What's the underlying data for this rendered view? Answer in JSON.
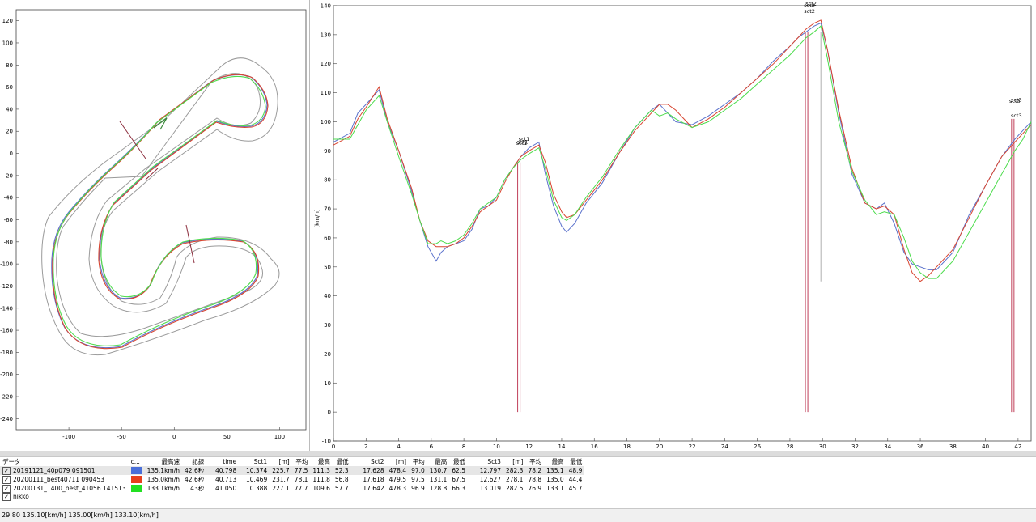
{
  "map": {
    "y_ticks": [
      "120",
      "100",
      "80",
      "60",
      "40",
      "20",
      "0",
      "-20",
      "-40",
      "-60",
      "-80",
      "-100",
      "-120",
      "-140",
      "-160",
      "-180",
      "-200",
      "-220",
      "-240"
    ],
    "x_ticks": [
      "-100",
      "-50",
      "0",
      "50",
      "100"
    ]
  },
  "speed_chart": {
    "ylabel": "[km/h]",
    "y_ticks": [
      "140",
      "130",
      "120",
      "110",
      "100",
      "90",
      "80",
      "70",
      "60",
      "50",
      "40",
      "30",
      "20",
      "10",
      "0",
      "-10"
    ],
    "x_ticks": [
      "0",
      "2",
      "4",
      "6",
      "8",
      "10",
      "12",
      "14",
      "16",
      "18",
      "20",
      "22",
      "24",
      "26",
      "28",
      "30",
      "32",
      "34",
      "36",
      "38",
      "40",
      "42"
    ],
    "sector_labels": [
      "sct1",
      "sct1",
      "sct1",
      "sct2",
      "sct2",
      "sct2",
      "sct3",
      "sct3",
      "sct3"
    ]
  },
  "chart_data": {
    "type": "line",
    "xlabel": "",
    "ylabel": "[km/h]",
    "xlim": [
      0,
      42.8
    ],
    "ylim": [
      -10,
      140
    ],
    "series": [
      {
        "name": "20191121_40p079 091501",
        "color": "#5b72cc",
        "x": [
          0,
          1,
          1.5,
          2,
          2.8,
          3.3,
          4,
          4.8,
          5.3,
          5.8,
          6.3,
          6.6,
          7,
          7.5,
          8,
          8.5,
          9,
          9.5,
          10,
          10.5,
          11,
          11.5,
          12,
          12.6,
          13,
          13.5,
          14,
          14.3,
          14.8,
          15.5,
          16.5,
          17.5,
          18.5,
          19.5,
          20,
          20.5,
          21,
          22,
          23,
          24,
          25,
          26,
          27,
          28,
          28.5,
          29,
          29.5,
          29.9,
          30.3,
          31,
          31.8,
          32.6,
          33.3,
          33.8,
          34.4,
          35.0,
          35.5,
          36,
          36.5,
          37,
          38,
          39,
          40,
          41,
          41.8,
          42.3,
          42.8
        ],
        "y": [
          93,
          96,
          103,
          106,
          111,
          100,
          90,
          76,
          66,
          57,
          52,
          55,
          57,
          58,
          59,
          63,
          70,
          71,
          74,
          80,
          84,
          88,
          91,
          93,
          82,
          71,
          64,
          62,
          65,
          72,
          79,
          89,
          98,
          104,
          106,
          103,
          100,
          99,
          102,
          106,
          110,
          115,
          121,
          126,
          129,
          131,
          133,
          134,
          125,
          103,
          82,
          72,
          70,
          72,
          65,
          55,
          51,
          50,
          49,
          49,
          55,
          68,
          78,
          88,
          94,
          97,
          100
        ]
      },
      {
        "name": "20200111_best40711 090453",
        "color": "#d84530",
        "x": [
          0,
          1,
          1.5,
          2,
          2.8,
          3.3,
          4,
          4.8,
          5.3,
          5.8,
          6.3,
          6.6,
          7,
          7.5,
          8,
          8.5,
          9,
          9.5,
          10,
          10.5,
          11,
          11.5,
          12,
          12.6,
          13,
          13.5,
          14,
          14.3,
          14.8,
          15.5,
          16.5,
          17.5,
          18.5,
          19.5,
          20,
          20.5,
          21,
          22,
          23,
          24,
          25,
          26,
          27,
          28,
          28.5,
          29,
          29.5,
          29.9,
          30.3,
          31,
          31.8,
          32.6,
          33.3,
          33.8,
          34.4,
          35.0,
          35.5,
          36,
          36.5,
          37,
          38,
          39,
          40,
          41,
          41.8,
          42.3,
          42.8
        ],
        "y": [
          92,
          95,
          101,
          105,
          112,
          101,
          90,
          77,
          66,
          59,
          57,
          57,
          57,
          58,
          60,
          64,
          69,
          71,
          73,
          79,
          84,
          88,
          90,
          92,
          86,
          75,
          69,
          67,
          68,
          73,
          80,
          89,
          97,
          103,
          106,
          106,
          104,
          98,
          101,
          105,
          110,
          115,
          120,
          126,
          129,
          132,
          134,
          135,
          125,
          104,
          84,
          72,
          70,
          71,
          68,
          56,
          48,
          45,
          47,
          50,
          56,
          67,
          78,
          88,
          93,
          96,
          99
        ]
      },
      {
        "name": "20200131_1400_best_41056 141513",
        "color": "#4ddc4d",
        "x": [
          0,
          1,
          1.5,
          2,
          2.8,
          3.3,
          4,
          4.8,
          5.3,
          5.8,
          6.3,
          6.6,
          7,
          7.5,
          8,
          8.5,
          9,
          9.5,
          10,
          10.5,
          11,
          11.5,
          12,
          12.6,
          13,
          13.5,
          14,
          14.3,
          14.8,
          15.5,
          16.5,
          17.5,
          18.5,
          19.5,
          20,
          20.5,
          21,
          22,
          23,
          24,
          25,
          26,
          27,
          28,
          28.5,
          29,
          29.5,
          29.9,
          30.3,
          31,
          31.8,
          32.6,
          33.3,
          33.8,
          34.4,
          35.0,
          35.5,
          36,
          36.5,
          37,
          38,
          39,
          40,
          41,
          41.8,
          42.3,
          42.8
        ],
        "y": [
          94,
          94,
          99,
          104,
          109,
          100,
          88,
          75,
          66,
          58,
          58,
          59,
          58,
          59,
          61,
          65,
          70,
          72,
          74,
          80,
          84,
          87,
          89,
          91,
          84,
          73,
          67,
          66,
          68,
          74,
          81,
          90,
          98,
          104,
          102,
          103,
          101,
          98,
          100,
          104,
          108,
          113,
          118,
          123,
          126,
          129,
          131,
          133,
          122,
          100,
          83,
          73,
          68,
          69,
          68,
          60,
          52,
          48,
          46,
          46,
          52,
          62,
          72,
          82,
          90,
          94,
          100
        ]
      }
    ],
    "sector_lines": [
      {
        "name": "sct1",
        "x": [
          11.3,
          11.45
        ]
      },
      {
        "name": "sct2",
        "x": [
          28.95,
          29.1,
          29.9
        ]
      },
      {
        "name": "sct3",
        "x": [
          41.6,
          41.75
        ]
      }
    ]
  },
  "table": {
    "headers": [
      "データ",
      "c...",
      "最高速",
      "記録",
      "time",
      "Sct1",
      "[m]",
      "平均",
      "最高",
      "最低",
      "Sct2",
      "[m]",
      "平均",
      "最高",
      "最低",
      "Sct3",
      "[m]",
      "平均",
      "最高",
      "最低"
    ],
    "rows": [
      {
        "name": "20191121_40p079 091501",
        "color": "#4a6fd8",
        "max": "135.1km/h",
        "rec": "42.6秒",
        "time": "40.798",
        "s1": "10.374",
        "s1m": "225.7",
        "s1avg": "77.5",
        "s1max": "111.3",
        "s1min": "52.3",
        "s2": "17.628",
        "s2m": "478.4",
        "s2avg": "97.0",
        "s2max": "130.7",
        "s2min": "62.5",
        "s3": "12.797",
        "s3m": "282.3",
        "s3avg": "78.2",
        "s3max": "135.1",
        "s3min": "48.9",
        "checked": true
      },
      {
        "name": "20200111_best40711 090453",
        "color": "#e8401c",
        "max": "135.0km/h",
        "rec": "42.6秒",
        "time": "40.713",
        "s1": "10.469",
        "s1m": "231.7",
        "s1avg": "78.1",
        "s1max": "111.8",
        "s1min": "56.8",
        "s2": "17.618",
        "s2m": "479.5",
        "s2avg": "97.5",
        "s2max": "131.1",
        "s2min": "67.5",
        "s3": "12.627",
        "s3m": "278.1",
        "s3avg": "78.8",
        "s3max": "135.0",
        "s3min": "44.4",
        "checked": true
      },
      {
        "name": "20200131_1400_best_41056 141513",
        "color": "#22e022",
        "max": "133.1km/h",
        "rec": "43秒",
        "time": "41.050",
        "s1": "10.388",
        "s1m": "227.1",
        "s1avg": "77.7",
        "s1max": "109.6",
        "s1min": "57.7",
        "s2": "17.642",
        "s2m": "478.3",
        "s2avg": "96.9",
        "s2max": "128.8",
        "s2min": "66.3",
        "s3": "13.019",
        "s3m": "282.5",
        "s3avg": "76.9",
        "s3max": "133.1",
        "s3min": "45.7",
        "checked": true
      }
    ],
    "course_row": {
      "name": "nikko",
      "checked": true
    }
  },
  "status": "29.80  135.10[km/h]  135.00[km/h]  133.10[km/h]"
}
